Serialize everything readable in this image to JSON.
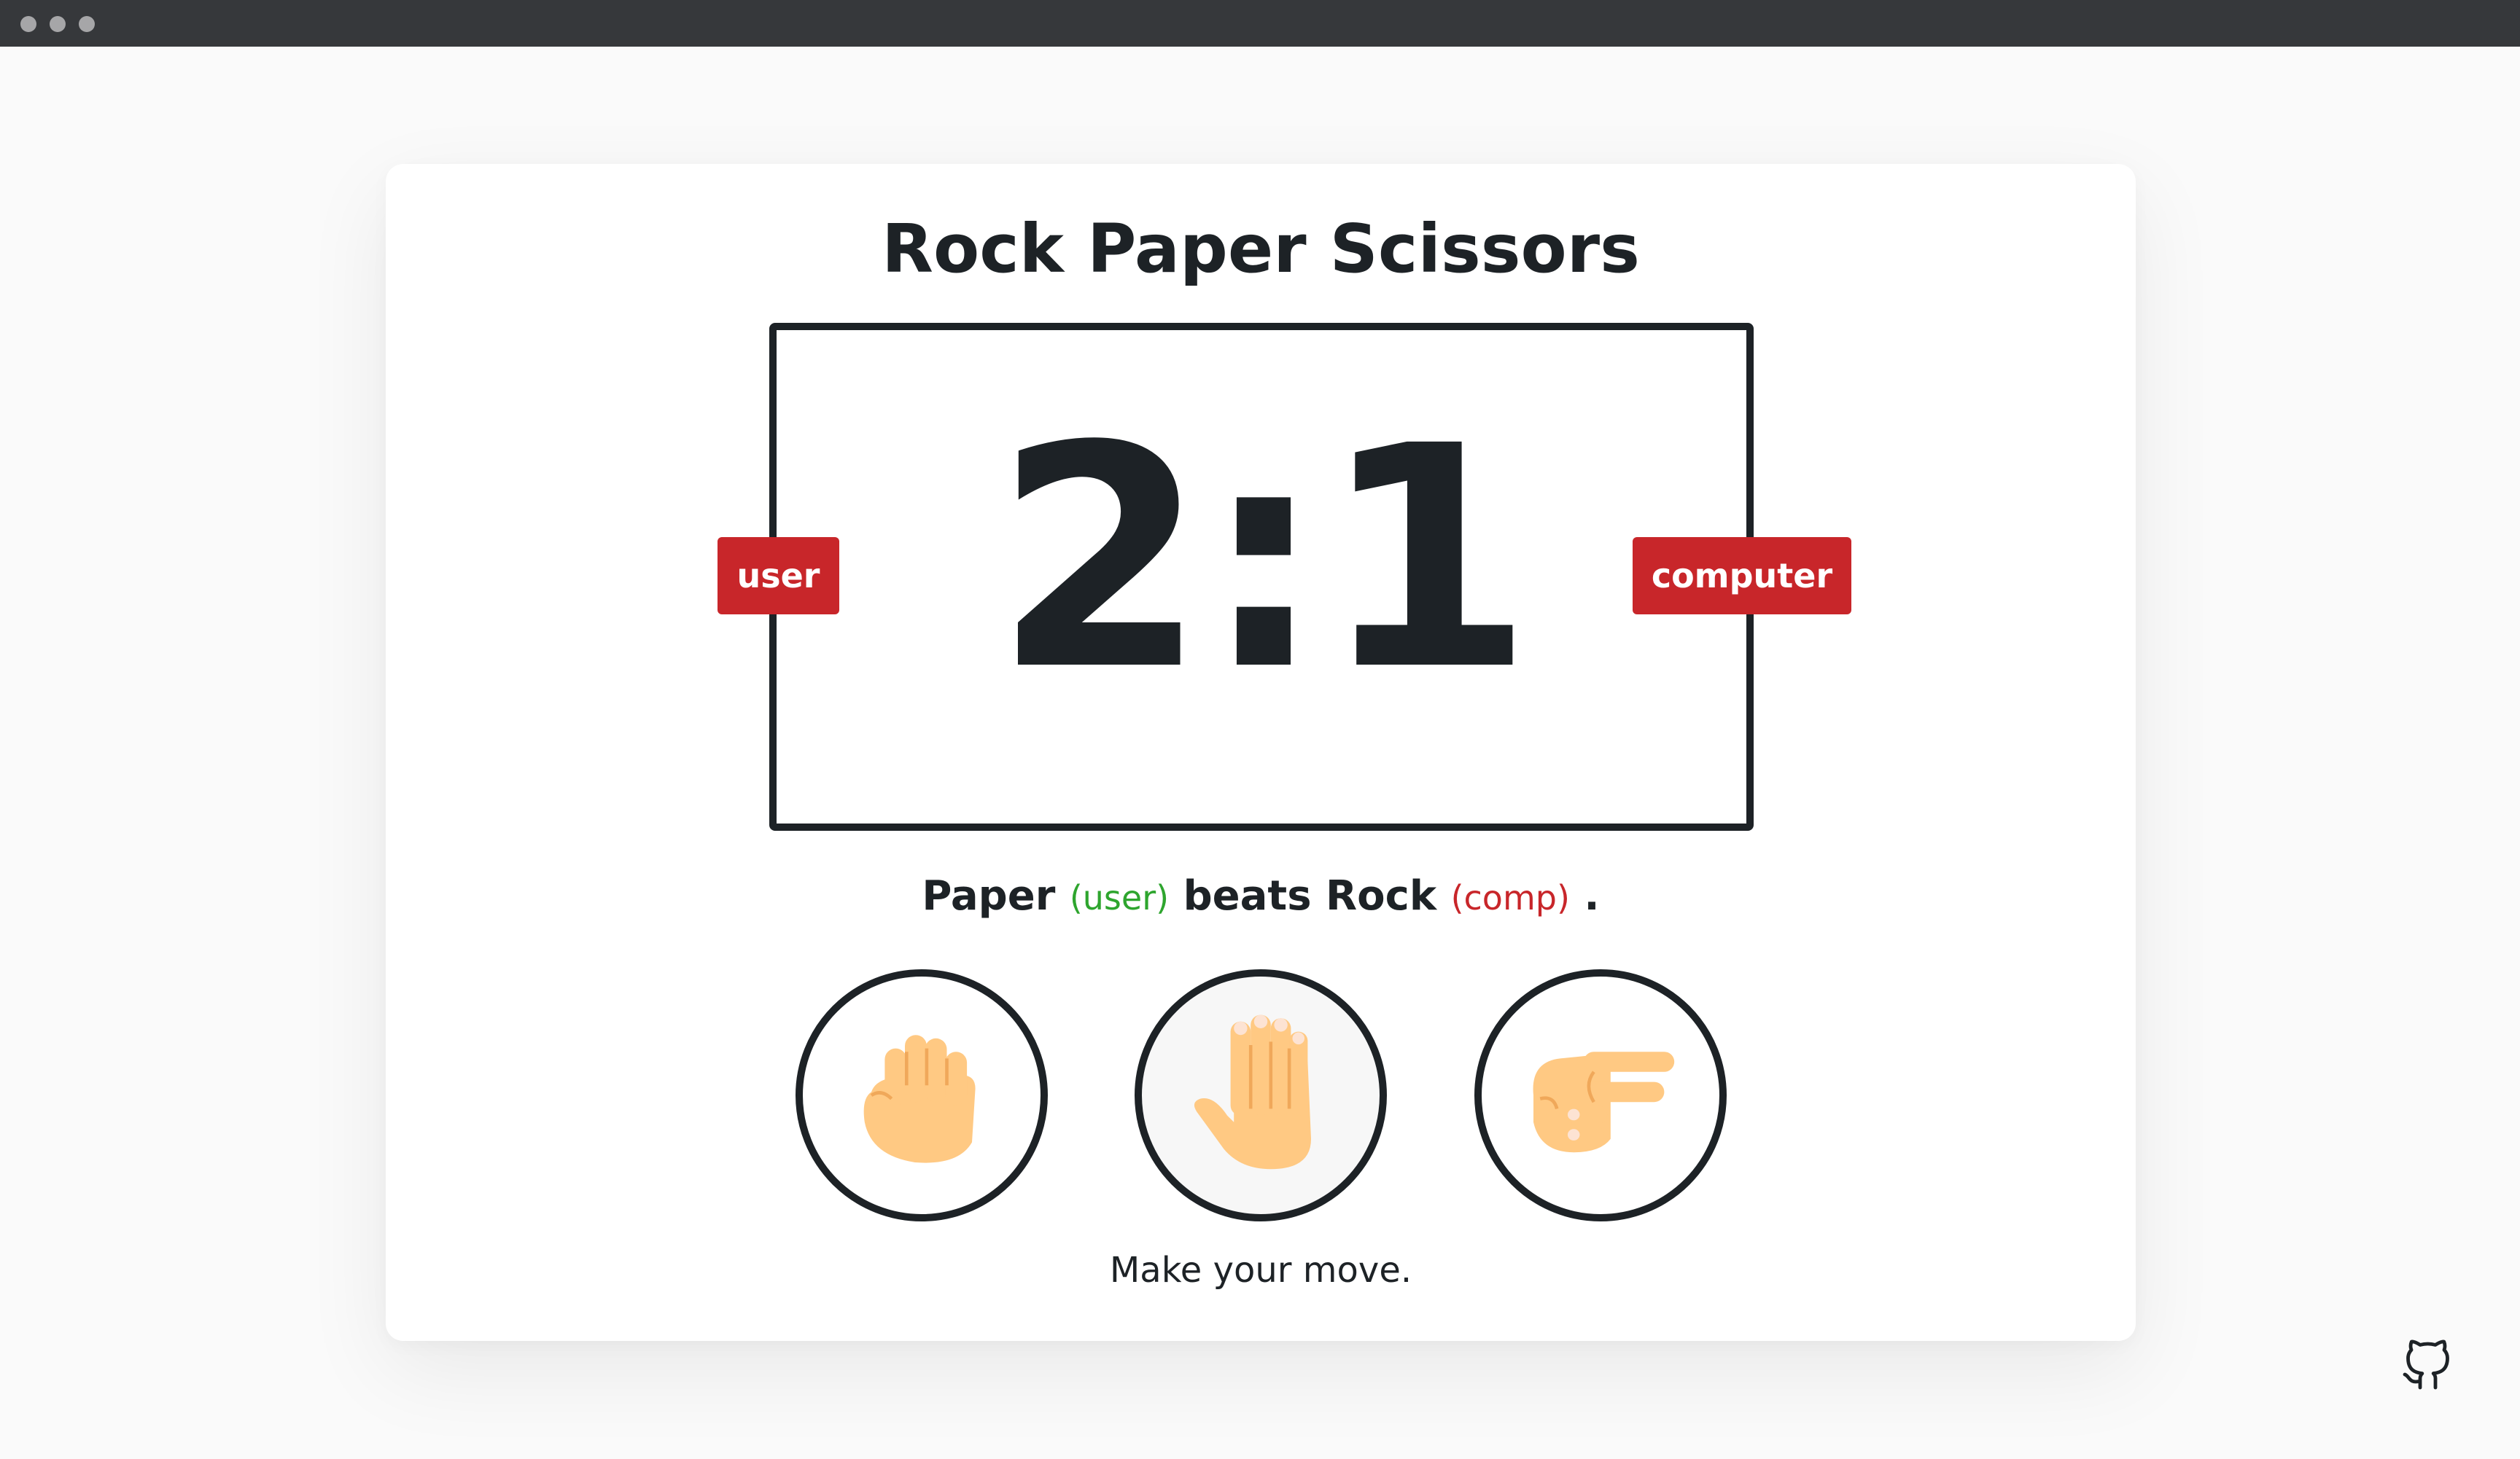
{
  "app": {
    "title": "Rock Paper Scissors",
    "score_text": "2:1",
    "user_label": "user",
    "computer_label": "computer",
    "accent_color": "#c8262a"
  },
  "result": {
    "user_move": "Paper",
    "user_tag": "(user)",
    "verb": "beats",
    "comp_move": "Rock",
    "comp_tag": "(comp)",
    "end": "."
  },
  "choices": [
    {
      "name": "rock",
      "icon": "rock-hand-icon",
      "selected": false
    },
    {
      "name": "paper",
      "icon": "paper-hand-icon",
      "selected": true
    },
    {
      "name": "scissors",
      "icon": "scissors-hand-icon",
      "selected": false
    }
  ],
  "prompt": "Make your move.",
  "footer": {
    "icon": "github-icon"
  }
}
